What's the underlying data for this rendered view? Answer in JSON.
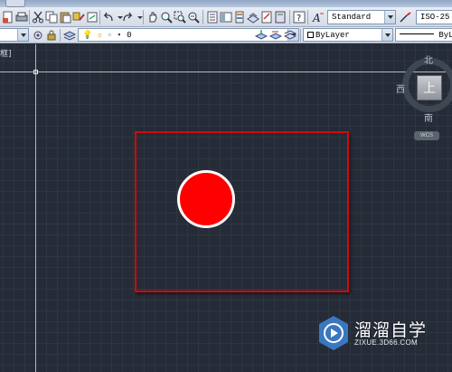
{
  "toolbar_top": {
    "text_style_value": "Standard",
    "dim_style_value": "ISO-25",
    "icons": [
      "new-icon",
      "open-icon",
      "plot-icon",
      "cut-icon",
      "copy-icon",
      "paste-icon",
      "match-properties-icon",
      "undo-icon",
      "redo-icon",
      "pan-icon",
      "zoom-realtime-icon",
      "zoom-window-icon",
      "zoom-previous-icon",
      "properties-icon",
      "design-center-icon",
      "tool-palettes-icon",
      "sheet-set-icon",
      "markup-icon",
      "calculator-icon",
      "help-icon",
      "text-style-icon",
      "dim-style-icon"
    ]
  },
  "toolbar_second": {
    "layer_value": "0",
    "color_value": "ByLayer",
    "linetype_value": "ByLa"
  },
  "viewport": {
    "label": "框]"
  },
  "viewcube": {
    "north": "北",
    "west": "西",
    "south": "南",
    "face": "上",
    "wcs": "WCS"
  },
  "drawing": {
    "rect_color": "#d10a0a",
    "circle_fill": "#ff0000",
    "circle_outline": "#ffffff"
  },
  "watermark": {
    "title": "溜溜自学",
    "url": "ZIXUE.3D66.COM"
  }
}
